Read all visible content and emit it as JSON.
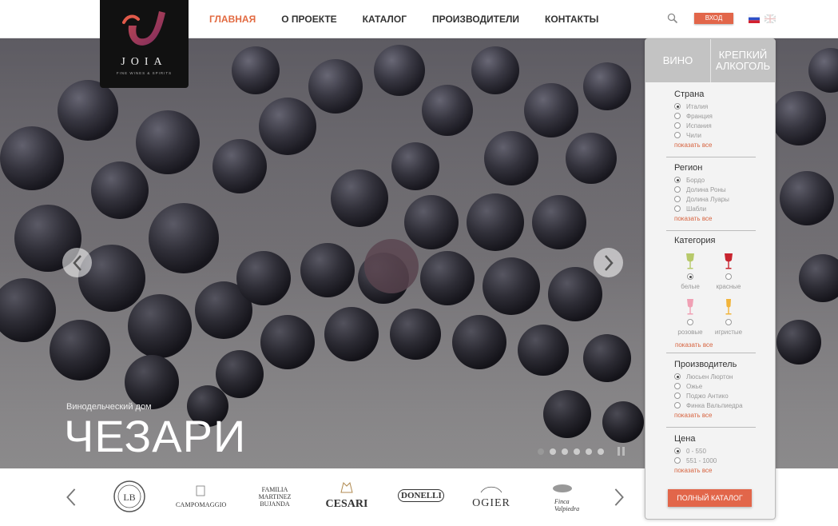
{
  "logo": {
    "name": "JOIA",
    "tagline": "FINE WINES & SPIRITS"
  },
  "nav": [
    {
      "label": "ГЛАВНАЯ",
      "active": true
    },
    {
      "label": "О ПРОЕКТЕ",
      "active": false
    },
    {
      "label": "КАТАЛОГ",
      "active": false
    },
    {
      "label": "ПРОИЗВОДИТЕЛИ",
      "active": false
    },
    {
      "label": "КОНТАКТЫ",
      "active": false
    }
  ],
  "header": {
    "login_label": "ВХОД",
    "languages": [
      "ru",
      "en"
    ],
    "active_language": "ru"
  },
  "hero": {
    "subtitle": "Винодельческий дом",
    "title": "ЧЕЗАРИ",
    "slides": 6,
    "active_slide": 1
  },
  "filters": {
    "tabs": [
      "ВИНО",
      "КРЕПКИЙ АЛКОГОЛЬ"
    ],
    "active_tab": 0,
    "show_all": "показать все",
    "country": {
      "title": "Страна",
      "options": [
        "Италия",
        "Франция",
        "Испания",
        "Чили"
      ],
      "selected": 0
    },
    "region": {
      "title": "Регион",
      "options": [
        "Бордо",
        "Долина Роны",
        "Долина Луары",
        "Шабли"
      ],
      "selected": 0
    },
    "category": {
      "title": "Категория",
      "options": [
        "белые",
        "красные",
        "розовые",
        "игристые"
      ],
      "selected": 0
    },
    "producer": {
      "title": "Производитель",
      "options": [
        "Люсьен Люртон",
        "Ожье",
        "Поджо Антико",
        "Финка Вальпиедра"
      ],
      "selected": 0
    },
    "price": {
      "title": "Цена",
      "options": [
        "0 - 550",
        "551 - 1000"
      ],
      "selected": 0
    },
    "full_catalog": "ПОЛНЫЙ КАТАЛОГ"
  },
  "brands": [
    "CAMPOMAGGIO",
    "FAMILIA MARTINEZ BUJANDA",
    "CESARI",
    "DONELLI",
    "OGIER",
    "Finca Valpiedra"
  ],
  "colors": {
    "accent": "#e26a41",
    "button": "#e2664a",
    "panel": "#f3f3f3",
    "tabs": "#c3c3c3"
  }
}
